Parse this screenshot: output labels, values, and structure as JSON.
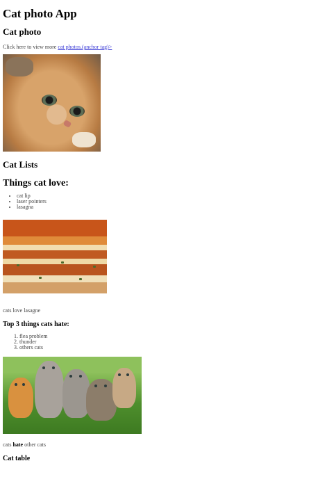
{
  "app_title": "Cat photo App",
  "photo_section": {
    "heading": "Cat photo",
    "prompt_text": "Click here to view more ",
    "link_text": "cat photos.(anchor tag)>"
  },
  "lists_section": {
    "heading": "Cat Lists",
    "love_heading": "Things cat love:",
    "love_items": [
      "cat lip",
      "laser pointers",
      "lasagna"
    ],
    "lasagna_caption": "cats love lasagne",
    "hate_heading": "Top 3 things cats hate:",
    "hate_items": [
      "flea problem",
      "thunder",
      "others cats"
    ],
    "hate_caption_before": "cats ",
    "hate_caption_bold": "hate",
    "hate_caption_after": " other cats"
  },
  "table_section": {
    "heading": "Cat table"
  }
}
